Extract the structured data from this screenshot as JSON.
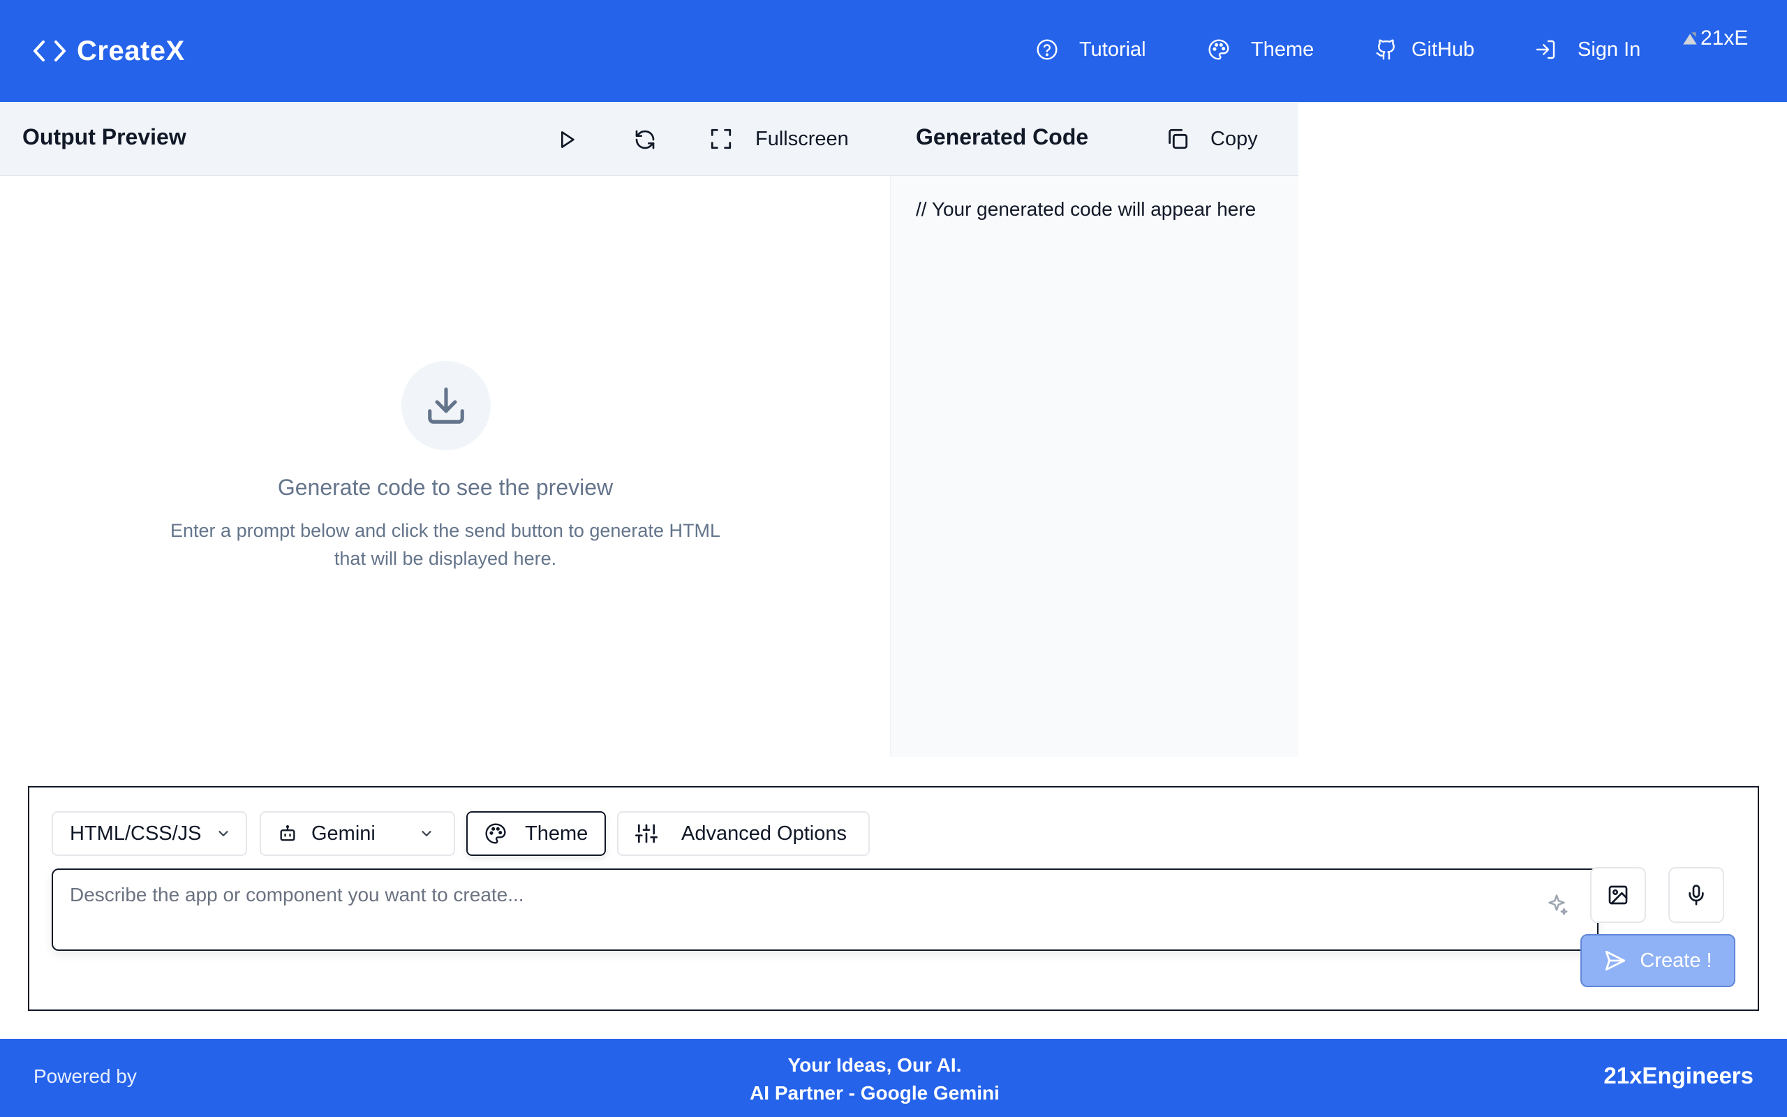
{
  "header": {
    "brand": "CreateX",
    "nav": [
      {
        "label": "Tutorial",
        "icon": "help-circle-icon"
      },
      {
        "label": "Theme",
        "icon": "palette-icon"
      },
      {
        "label": "GitHub",
        "icon": "github-icon"
      },
      {
        "label": "Sign In",
        "icon": "sign-in-icon"
      }
    ],
    "avatar_alt": "21xE"
  },
  "preview": {
    "title": "Output Preview",
    "fullscreen_label": "Fullscreen",
    "empty_title": "Generate code to see the preview",
    "empty_desc_line1": "Enter a prompt below and click the send button to generate HTML",
    "empty_desc_line2": "that will be displayed here."
  },
  "code": {
    "title": "Generated Code",
    "copy_label": "Copy",
    "placeholder_text": "// Your generated code will appear here"
  },
  "prompt": {
    "language_select": "HTML/CSS/JS",
    "model_select": "Gemini",
    "theme_label": "Theme",
    "advanced_label": "Advanced Options",
    "input_placeholder": "Describe the app or component you want to create...",
    "create_label": "Create !"
  },
  "footer": {
    "powered_by": "Powered by",
    "tagline_line1": "Your Ideas, Our AI.",
    "tagline_line2": "AI Partner - Google Gemini",
    "company": "21xEngineers"
  },
  "colors": {
    "brand_blue": "#2563eb",
    "create_button": "#8fb1f5",
    "muted_text": "#64748b"
  }
}
